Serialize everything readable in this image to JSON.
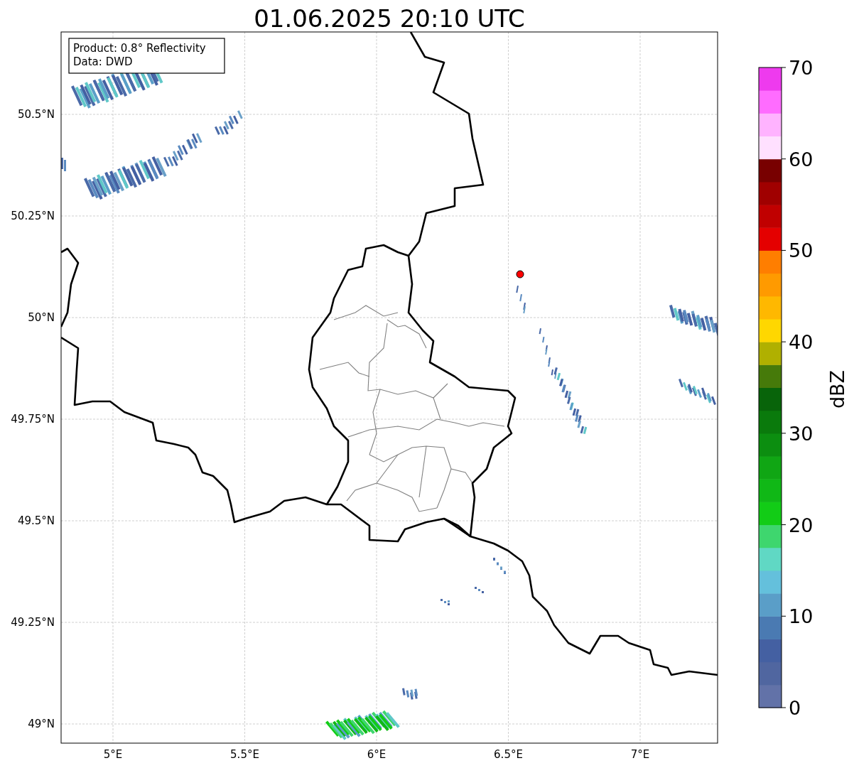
{
  "title": "01.06.2025 20:10 UTC",
  "info_box": [
    "Product: 0.8° Reflectivity",
    "Data: DWD"
  ],
  "map": {
    "lat_labels": [
      "50.5°N",
      "50.25°N",
      "50°N",
      "49.75°N",
      "49.5°N",
      "49.25°N",
      "49°N"
    ],
    "lon_labels": [
      "5°E",
      "5.5°E",
      "6°E",
      "6.5°E",
      "7°E"
    ]
  },
  "colorbar": {
    "label": "dBZ",
    "ticks": [
      "70",
      "60",
      "50",
      "40",
      "30",
      "20",
      "10",
      "0"
    ],
    "bands": [
      {
        "color": "#6272a8"
      },
      {
        "color": "#5066a0"
      },
      {
        "color": "#4460a2"
      },
      {
        "color": "#4a7ab2"
      },
      {
        "color": "#5a9ec8"
      },
      {
        "color": "#64c0dc"
      },
      {
        "color": "#60d8c4"
      },
      {
        "color": "#3ed66e"
      },
      {
        "color": "#12cc16"
      },
      {
        "color": "#10b816"
      },
      {
        "color": "#10a614"
      },
      {
        "color": "#0c8e10"
      },
      {
        "color": "#0a7a0c"
      },
      {
        "color": "#08640a"
      },
      {
        "color": "#467a0a"
      },
      {
        "color": "#b0b000"
      },
      {
        "color": "#ffd700"
      },
      {
        "color": "#ffb800"
      },
      {
        "color": "#ff9a00"
      },
      {
        "color": "#ff7e00"
      },
      {
        "color": "#e40000"
      },
      {
        "color": "#c00000"
      },
      {
        "color": "#a00000"
      },
      {
        "color": "#780000"
      },
      {
        "color": "#ffe0ff"
      },
      {
        "color": "#ffb3ff"
      },
      {
        "color": "#ff6cff"
      },
      {
        "color": "#ee3aee"
      }
    ]
  }
}
